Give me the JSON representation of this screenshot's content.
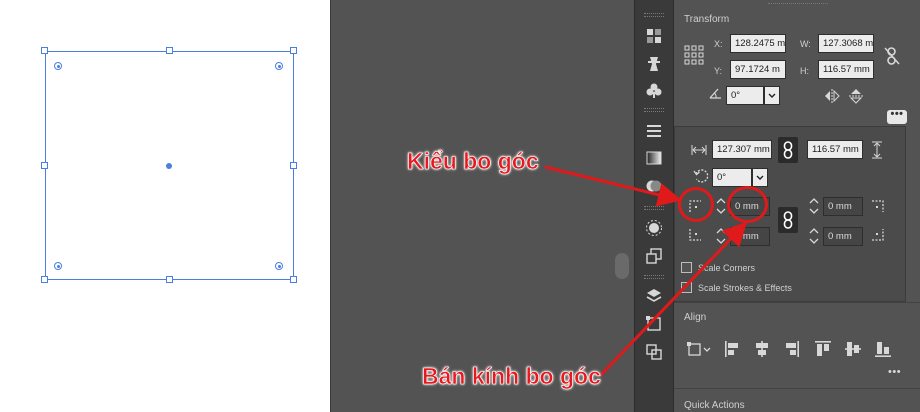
{
  "transform": {
    "title": "Transform",
    "x_label": "X:",
    "x_value": "128.2475 m",
    "y_label": "Y:",
    "y_value": "97.1724 m",
    "w_label": "W:",
    "w_value": "127.3068 m",
    "h_label": "H:",
    "h_value": "116.57 mm",
    "angle_value": "0°"
  },
  "more_options": {
    "width_value": "127.307 mm",
    "height_value": "116.57 mm",
    "rotate_value": "0°",
    "corner_tl": "0 mm",
    "corner_tr": "0 mm",
    "corner_bl": "0 mm",
    "corner_br": "0 mm",
    "scale_corners_label": "Scale Corners",
    "scale_strokes_label": "Scale Strokes & Effects",
    "scale_corners_checked": false,
    "scale_strokes_checked": false
  },
  "align": {
    "title": "Align"
  },
  "quick_actions": {
    "title": "Quick Actions"
  },
  "more_button": "•••",
  "annotations": {
    "corner_type": "Kiểu bo góc",
    "corner_radius": "Bán kính bo góc",
    "color": "#e01a1a"
  },
  "colors": {
    "selection": "#4a7fe0",
    "panel_bg": "#535353",
    "toolstrip_bg": "#3a3a3a"
  }
}
